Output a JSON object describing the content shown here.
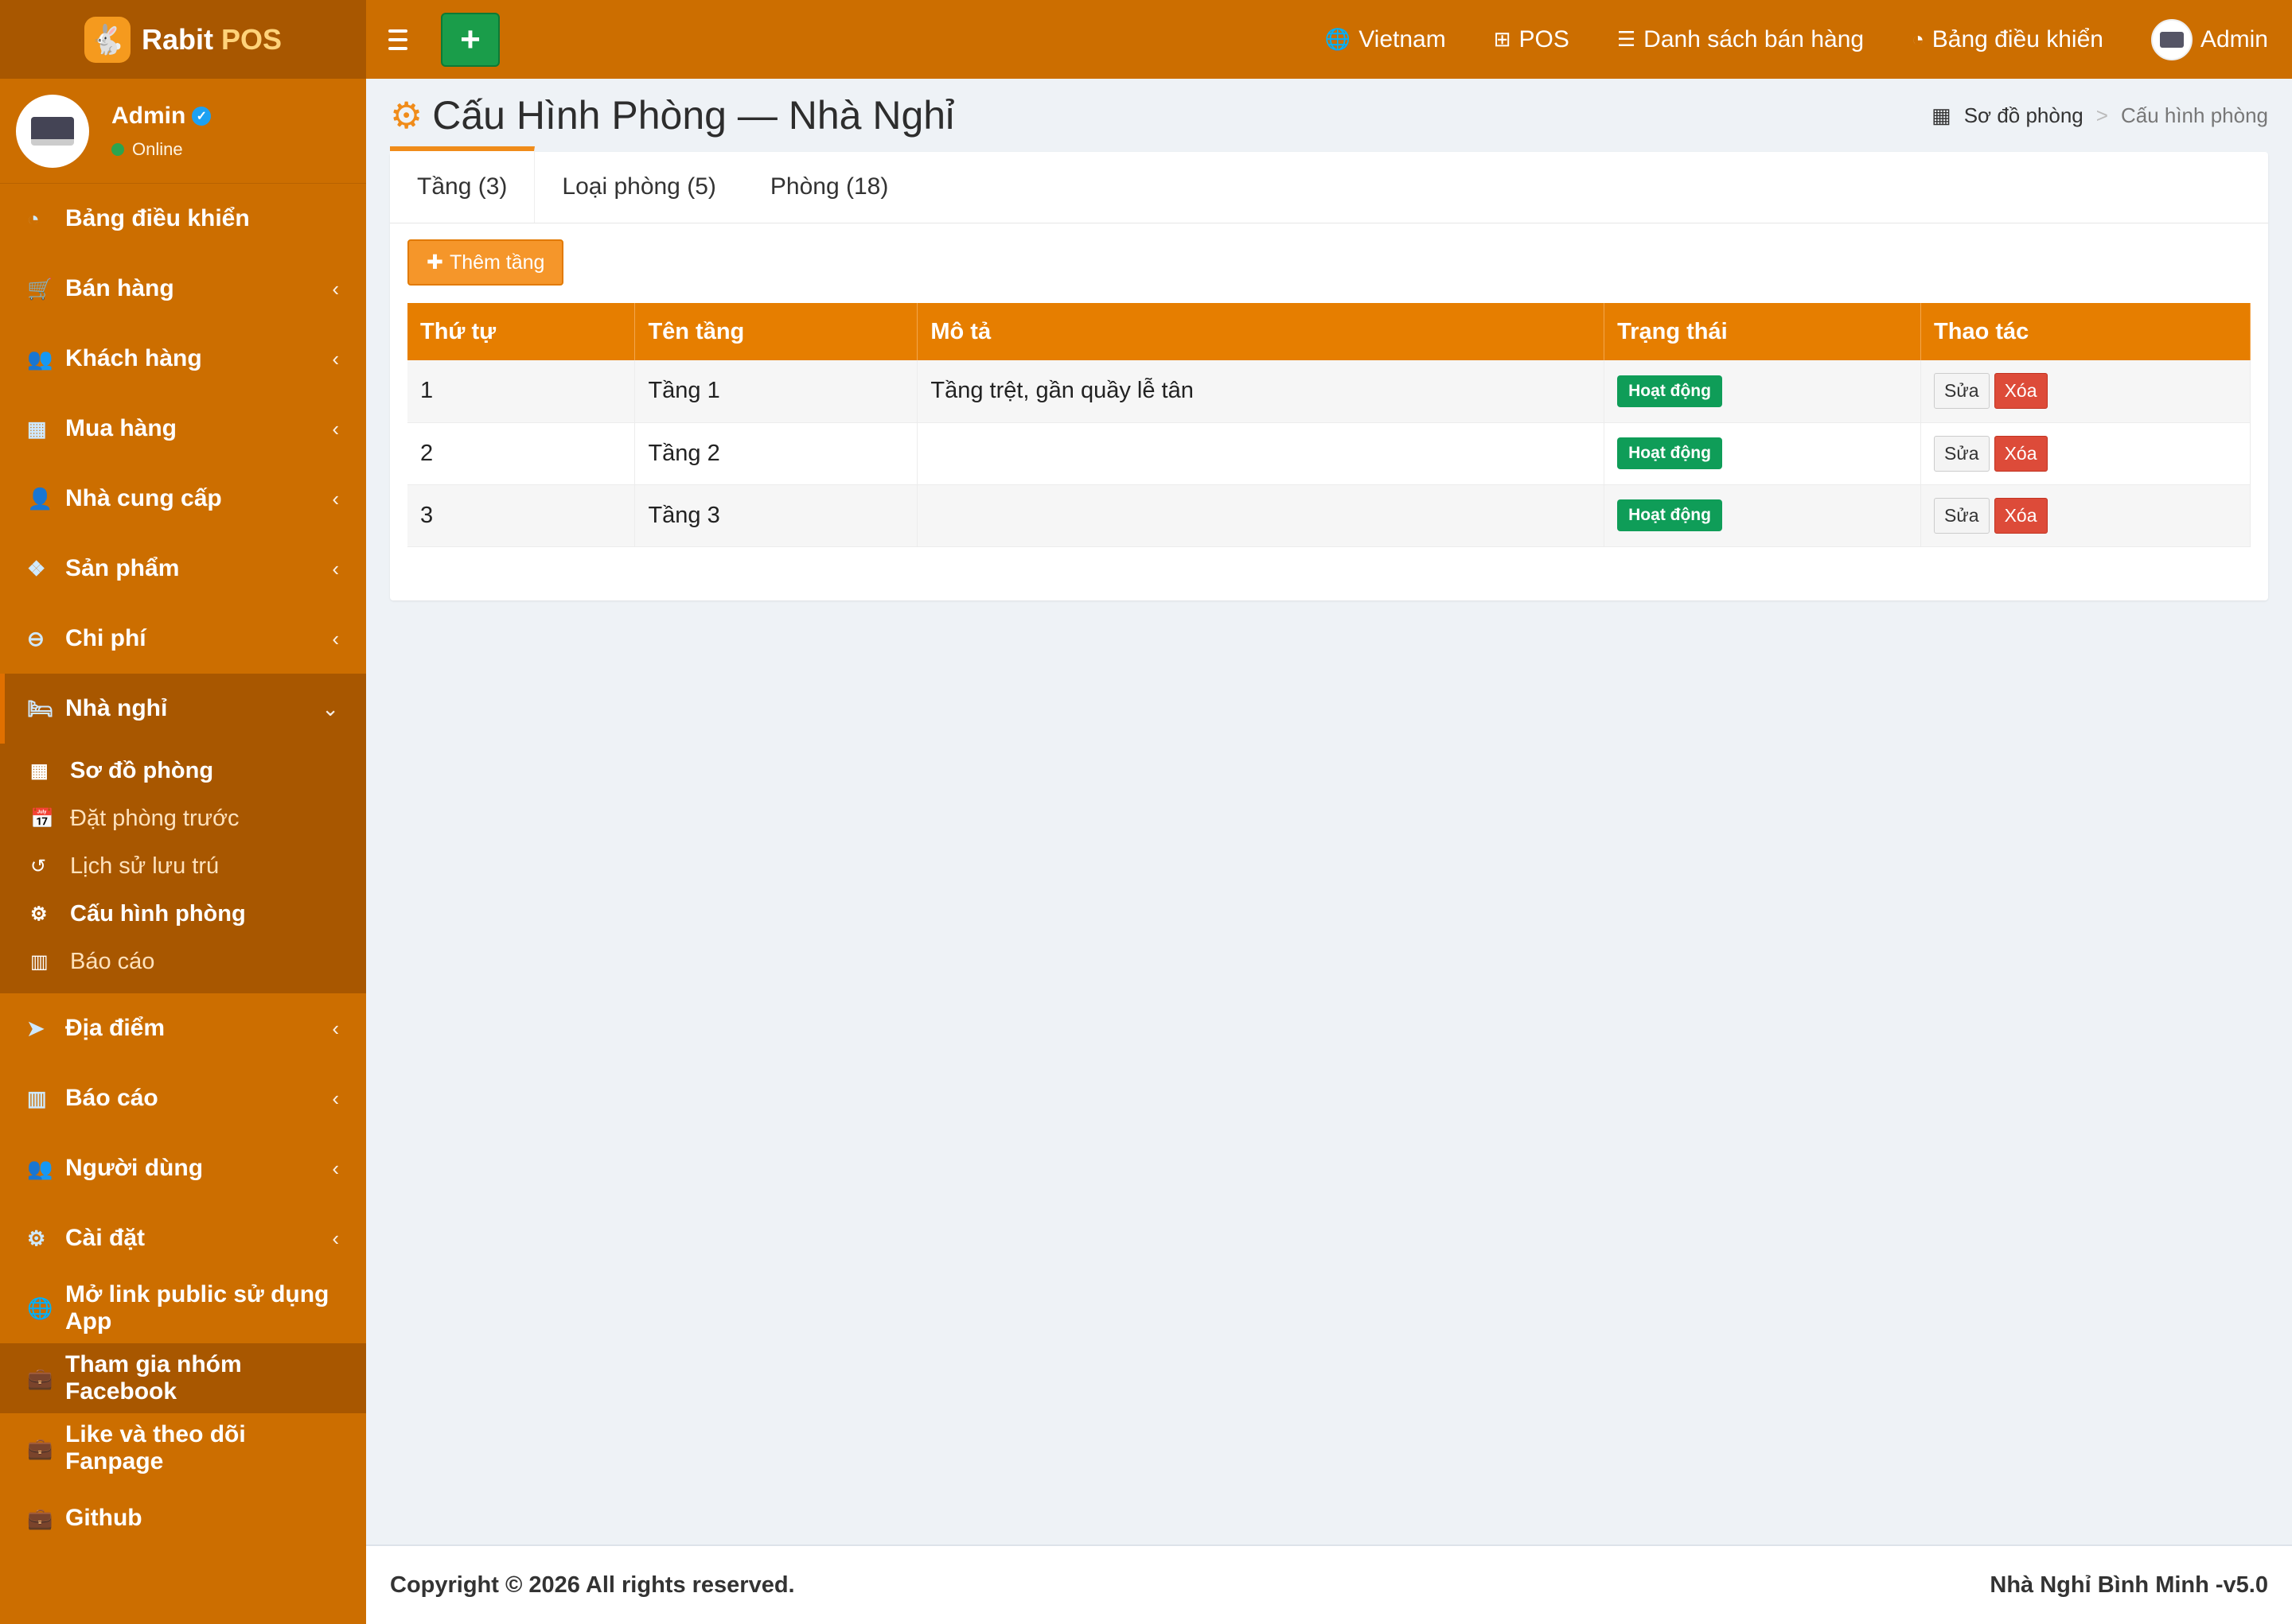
{
  "header": {
    "brand_name": "Rabit",
    "brand_accent": "POS",
    "add_label": "+",
    "nav": [
      {
        "icon": "language-icon",
        "label": "Vietnam"
      },
      {
        "icon": "plus-square-icon",
        "label": "POS"
      },
      {
        "icon": "list-icon",
        "label": "Danh sách bán hàng"
      },
      {
        "icon": "dashboard-icon",
        "label": "Bảng điều khiển"
      }
    ],
    "user_label": "Admin"
  },
  "sidebar": {
    "user": {
      "name": "Admin",
      "status": "Online"
    },
    "items": [
      {
        "label": "Bảng điều khiển",
        "icon": "dashboard-icon"
      },
      {
        "label": "Bán hàng",
        "icon": "cart-icon"
      },
      {
        "label": "Khách hàng",
        "icon": "users-icon"
      },
      {
        "label": "Mua hàng",
        "icon": "grid-icon"
      },
      {
        "label": "Nhà cung cấp",
        "icon": "user-plus-icon"
      },
      {
        "label": "Sản phẩm",
        "icon": "cubes-icon"
      },
      {
        "label": "Chi phí",
        "icon": "minus-circle-icon"
      },
      {
        "label": "Nhà nghỉ",
        "icon": "bed-icon"
      },
      {
        "label": "Địa điểm",
        "icon": "send-icon"
      },
      {
        "label": "Báo cáo",
        "icon": "bar-chart-icon"
      },
      {
        "label": "Người dùng",
        "icon": "users-icon"
      },
      {
        "label": "Cài đặt",
        "icon": "cogs-icon"
      },
      {
        "label": "Mở link public sử dụng App",
        "icon": "globe-icon"
      },
      {
        "label": "Tham gia nhóm Facebook",
        "icon": "briefcase-icon"
      },
      {
        "label": "Like và theo dõi Fanpage",
        "icon": "briefcase-icon"
      },
      {
        "label": "Github",
        "icon": "briefcase-icon"
      }
    ],
    "submenu": [
      {
        "label": "Sơ đồ phòng",
        "icon": "th-large-icon"
      },
      {
        "label": "Đặt phòng trước",
        "icon": "calendar-check-icon"
      },
      {
        "label": "Lịch sử lưu trú",
        "icon": "history-icon"
      },
      {
        "label": "Cấu hình phòng",
        "icon": "cogs-icon"
      },
      {
        "label": "Báo cáo",
        "icon": "bar-chart-icon"
      }
    ]
  },
  "page": {
    "title": "Cấu Hình Phòng — Nhà Nghỉ",
    "breadcrumb": [
      "Sơ đồ phòng",
      "Cấu hình phòng"
    ],
    "tabs": [
      "Tầng (3)",
      "Loại phòng (5)",
      "Phòng (18)"
    ],
    "add_button": "Thêm tầng",
    "table": {
      "headers": [
        "Thứ tự",
        "Tên tầng",
        "Mô tả",
        "Trạng thái",
        "Thao tác"
      ],
      "rows": [
        {
          "order": "1",
          "name": "Tầng 1",
          "desc": "Tầng trệt, gần quầy lễ tân",
          "status": "Hoạt động"
        },
        {
          "order": "2",
          "name": "Tầng 2",
          "desc": "",
          "status": "Hoạt động"
        },
        {
          "order": "3",
          "name": "Tầng 3",
          "desc": "",
          "status": "Hoạt động"
        }
      ],
      "edit_label": "Sửa",
      "delete_label": "Xóa"
    }
  },
  "footer": {
    "copyright": "Copyright © 2026 All rights reserved.",
    "version": "Nhà Nghỉ Bình Minh -v5.0"
  }
}
